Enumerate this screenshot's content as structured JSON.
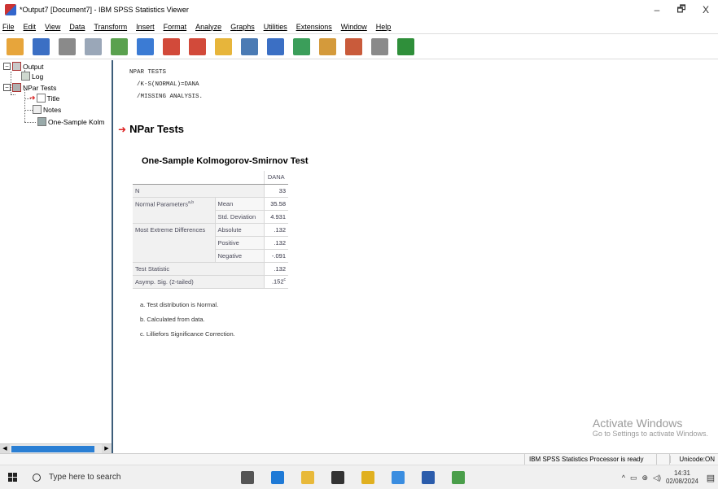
{
  "window": {
    "title": "*Output7 [Document7] - IBM SPSS Statistics Viewer",
    "minimize": "–",
    "maximize": "🗗",
    "close": "X"
  },
  "menu": [
    "File",
    "Edit",
    "View",
    "Data",
    "Transform",
    "Insert",
    "Format",
    "Analyze",
    "Graphs",
    "Utilities",
    "Extensions",
    "Window",
    "Help"
  ],
  "toolbar": [
    {
      "name": "open-icon",
      "color": "#e7a53b"
    },
    {
      "name": "save-icon",
      "color": "#3b6fc4"
    },
    {
      "name": "print-icon",
      "color": "#8a8a8a"
    },
    {
      "name": "print-preview-icon",
      "color": "#9aa7b8"
    },
    {
      "name": "export-icon",
      "color": "#5aa14e"
    },
    {
      "name": "goto-data-icon",
      "color": "#3b7bd4"
    },
    {
      "name": "undo-icon",
      "color": "#d24a3a"
    },
    {
      "name": "redo-icon",
      "color": "#d24a3a"
    },
    {
      "name": "goto-case-icon",
      "color": "#e7b53b"
    },
    {
      "name": "goto-variable-icon",
      "color": "#4b7bb4"
    },
    {
      "name": "variables-icon",
      "color": "#3b6fc4"
    },
    {
      "name": "insert-output-icon",
      "color": "#3b9e5a"
    },
    {
      "name": "designate-window-icon",
      "color": "#d49a3b"
    },
    {
      "name": "show-all-icon",
      "color": "#c95b3b"
    },
    {
      "name": "hide-icon",
      "color": "#8a8a8a"
    },
    {
      "name": "expand-icon",
      "color": "#2f8f3a"
    }
  ],
  "navigator": {
    "output": "Output",
    "log": "Log",
    "npar_tests": "NPar Tests",
    "title": "Title",
    "notes": "Notes",
    "one_sample": "One-Sample Kolm"
  },
  "syntax": "NPAR TESTS\n  /K-S(NORMAL)=DANA\n  /MISSING ANALYSIS.",
  "heading": "NPar Tests",
  "table": {
    "title": "One-Sample Kolmogorov-Smirnov Test",
    "column": "DANA",
    "rows": {
      "n_label": "N",
      "n_value": "33",
      "normal_label": "Normal Parameters",
      "normal_sup": "a,b",
      "mean_label": "Mean",
      "mean_value": "35.58",
      "sd_label": "Std. Deviation",
      "sd_value": "4.931",
      "med_label": "Most Extreme Differences",
      "abs_label": "Absolute",
      "abs_value": ".132",
      "pos_label": "Positive",
      "pos_value": ".132",
      "neg_label": "Negative",
      "neg_value": "-.091",
      "ts_label": "Test Statistic",
      "ts_value": ".132",
      "sig_label": "Asymp. Sig. (2-tailed)",
      "sig_value": ".152",
      "sig_sup": "c"
    },
    "footnotes": [
      "a. Test distribution is Normal.",
      "b. Calculated from data.",
      "c. Lilliefors Significance Correction."
    ]
  },
  "watermark": {
    "line1": "Activate Windows",
    "line2": "Go to Settings to activate Windows."
  },
  "status": {
    "text": "IBM SPSS Statistics Processor is ready",
    "encoding": "Unicode:ON"
  },
  "taskbar": {
    "search_placeholder": "Type here to search",
    "time": "14:31",
    "date": "02/08/2024",
    "apps": [
      {
        "name": "task-view-icon",
        "color": "#555555"
      },
      {
        "name": "edge-icon",
        "color": "#1f7ad6"
      },
      {
        "name": "file-explorer-icon",
        "color": "#e8b93a"
      },
      {
        "name": "mail-icon",
        "color": "#333333"
      },
      {
        "name": "sticky-notes-icon",
        "color": "#e0b020"
      },
      {
        "name": "chrome-icon",
        "color": "#3a8de0"
      },
      {
        "name": "word-icon",
        "color": "#2b5cab"
      },
      {
        "name": "spss-data-icon",
        "color": "#4a9e4a"
      }
    ]
  }
}
